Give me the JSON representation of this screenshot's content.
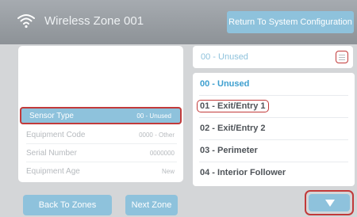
{
  "header": {
    "title": "Wireless Zone 001",
    "return_label": "Return To System Configuration"
  },
  "details": {
    "rows": [
      {
        "label": "Sensor Type",
        "value": "00 - Unused"
      },
      {
        "label": "Equipment Code",
        "value": "0000 - Other"
      },
      {
        "label": "Serial Number",
        "value": "0000000"
      },
      {
        "label": "Equipment Age",
        "value": "New"
      }
    ]
  },
  "footer": {
    "back_label": "Back To Zones",
    "next_label": "Next Zone"
  },
  "select": {
    "value": "00 - Unused",
    "options": [
      "00 - Unused",
      "01 - Exit/Entry 1",
      "02 - Exit/Entry 2",
      "03 - Perimeter",
      "04 - Interior Follower"
    ]
  },
  "colors": {
    "accent": "#8ec2dc",
    "highlight": "#c23a3a",
    "header": "#9a9fa4"
  }
}
